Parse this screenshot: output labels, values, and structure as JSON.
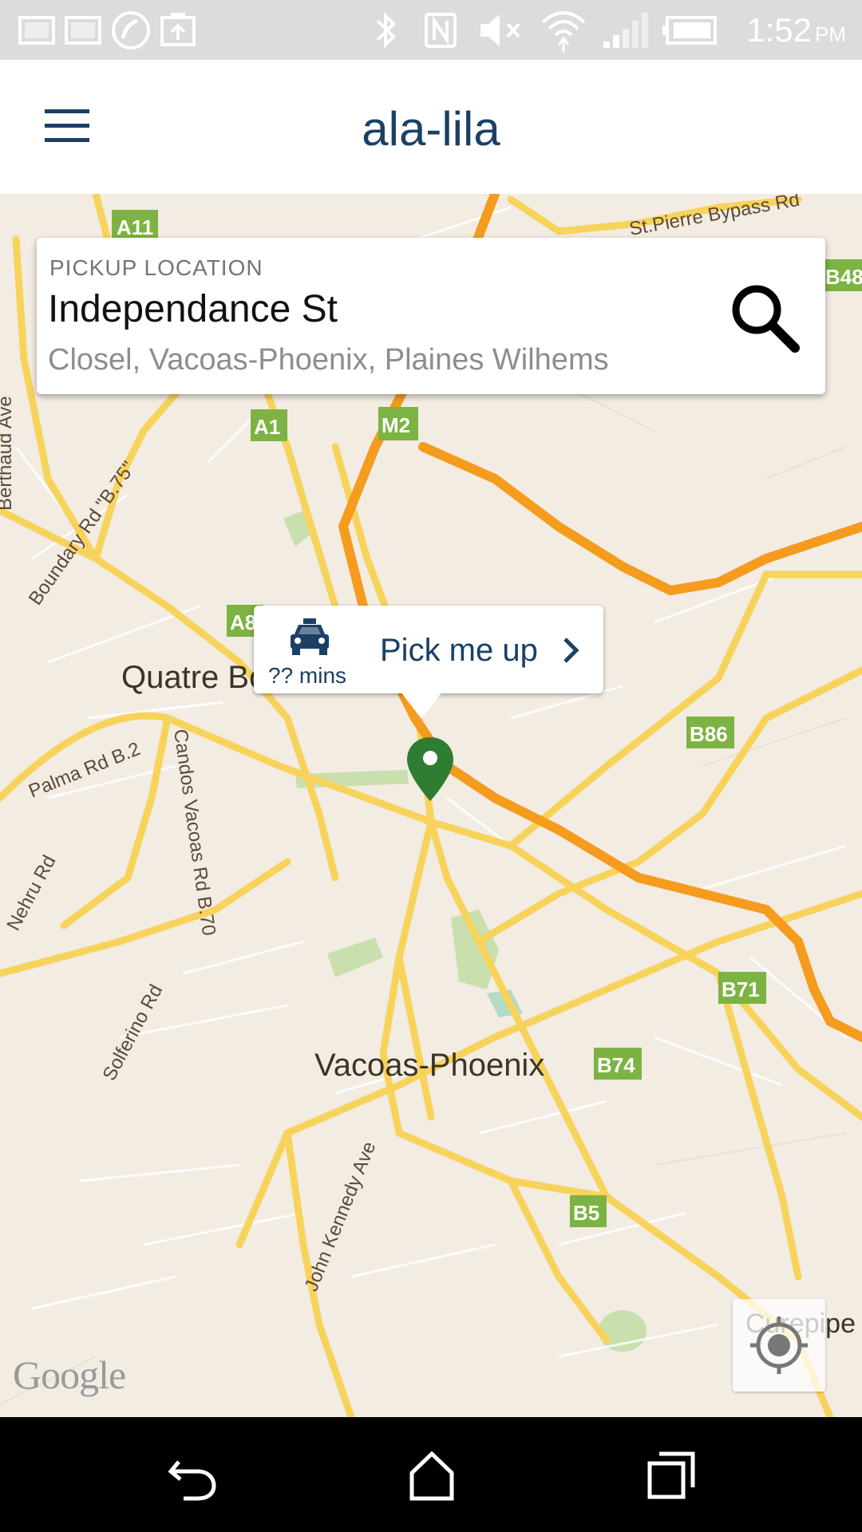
{
  "status_bar": {
    "time": "1:52",
    "ampm": "PM",
    "icons": [
      "gallery-notification-icon",
      "gallery-notification-icon",
      "phone-call-icon",
      "clipboard-upload-icon",
      "bluetooth-icon",
      "nfc-icon",
      "mute-icon",
      "wifi-icon",
      "cellular-signal-icon",
      "battery-icon"
    ]
  },
  "app_bar": {
    "title": "ala-lila",
    "menu_icon": "hamburger-menu-icon"
  },
  "pickup": {
    "label": "PICKUP LOCATION",
    "street": "Independance St",
    "area": "Closel, Vacoas-Phoenix, Plaines Wilhems",
    "search_icon": "search-icon"
  },
  "pick_bubble": {
    "eta": "?? mins",
    "label": "Pick me up",
    "taxi_icon": "taxi-icon",
    "chevron_icon": "chevron-right-icon"
  },
  "map": {
    "places": [
      "Quatre Bornes",
      "Vacoas-Phoenix",
      "Curepipe"
    ],
    "places_visible": [
      "Quatre Bo",
      "Vacoas-Phoenix",
      "Curepipe"
    ],
    "roads": [
      "St.Pierre Bypass Rd",
      "Berthaud Ave",
      "Boundary Rd \"B.75\"",
      "Palma Rd B.2",
      "Candos Vacoas Rd B.70",
      "Nehru Rd",
      "Solferino Rd",
      "John Kennedy Ave"
    ],
    "route_shields": [
      "A11",
      "B48",
      "A1",
      "M2",
      "A8",
      "B86",
      "B71",
      "B74",
      "B5"
    ],
    "attribution": "Google",
    "marker_color": "#2e7d32",
    "motorway_color": "#f59b1e",
    "road_color": "#f7d35c",
    "shield_color": "#7cb342"
  },
  "locate_icon": "my-location-icon",
  "nav_bar": {
    "icons": [
      "back-icon",
      "home-icon",
      "recent-apps-icon"
    ]
  }
}
